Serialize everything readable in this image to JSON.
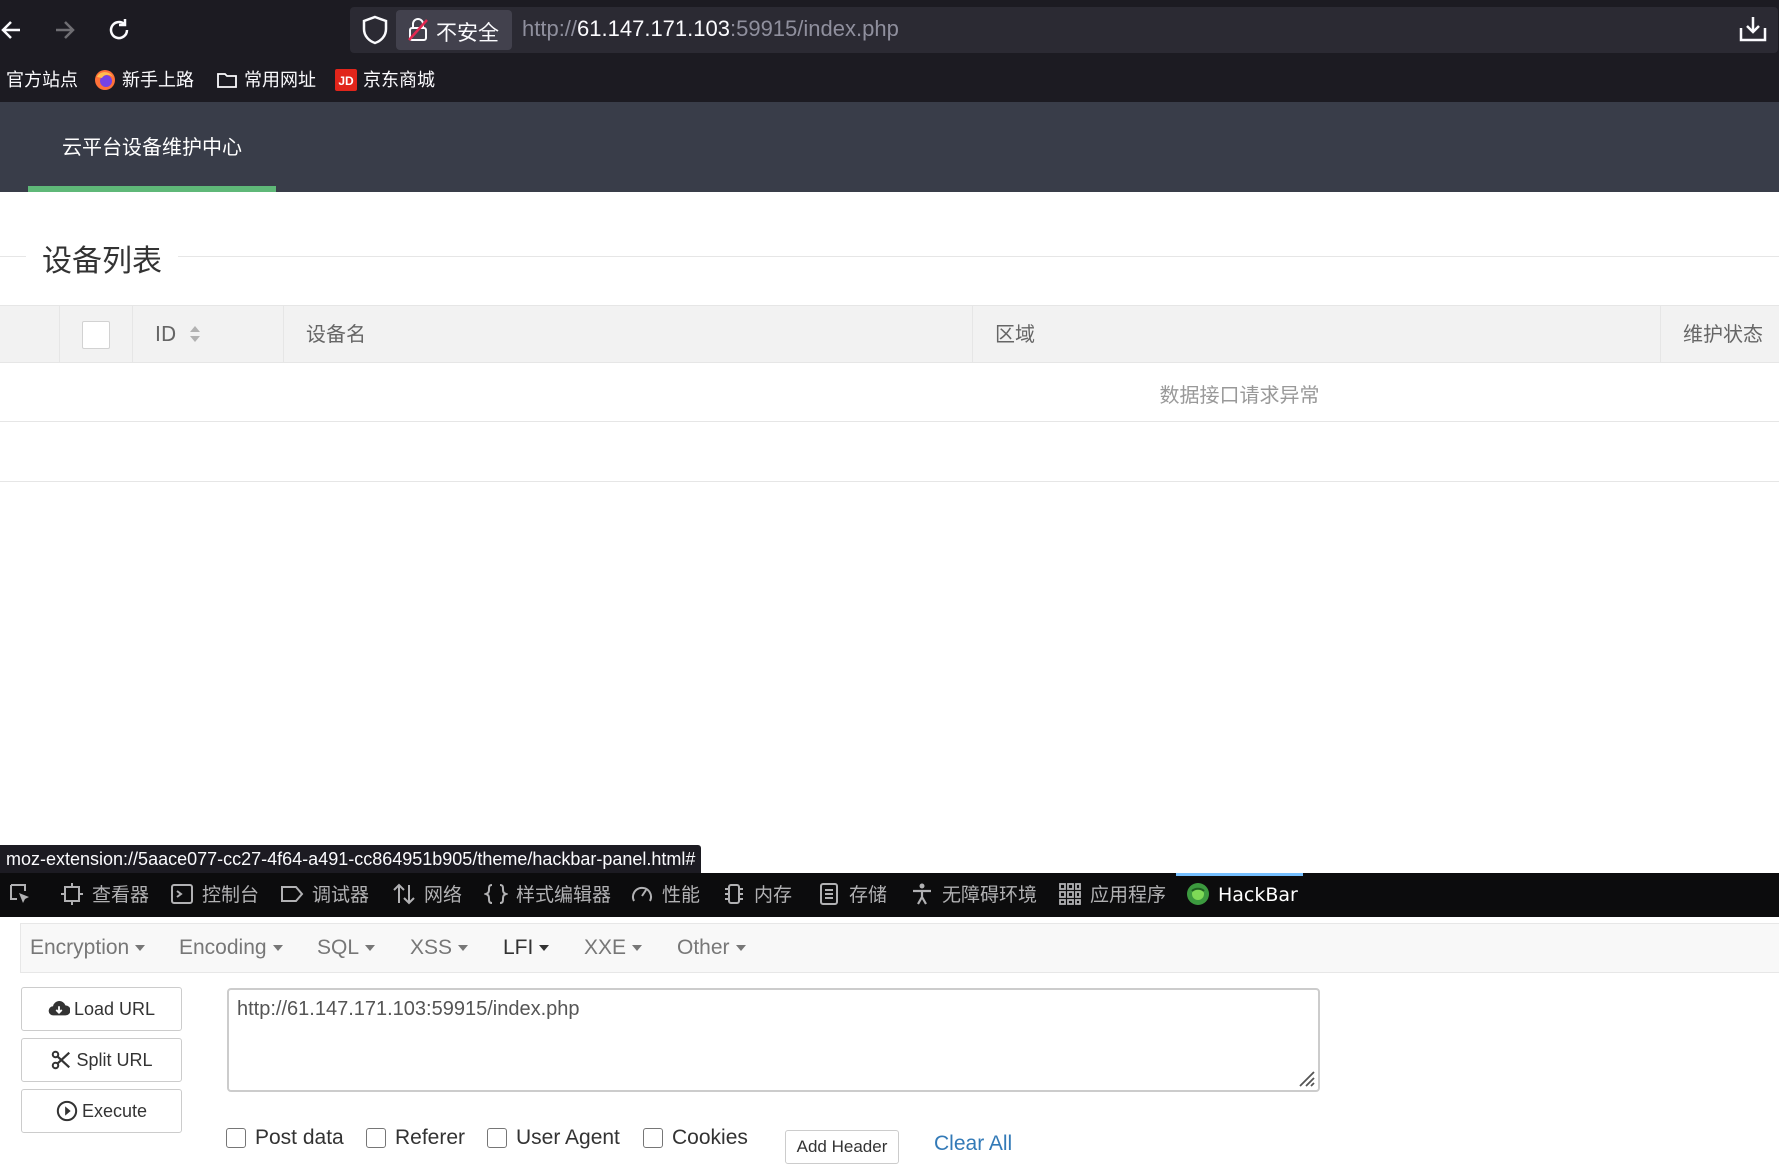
{
  "browser": {
    "insecure_label": "不安全",
    "url_scheme": "http://",
    "url_host": "61.147.171.103",
    "url_rest": ":59915/index.php",
    "bookmarks": [
      {
        "label": "官方站点",
        "icon": "firefox-partial-icon"
      },
      {
        "label": "新手上路",
        "icon": "firefox-icon"
      },
      {
        "label": "常用网址",
        "icon": "folder-icon"
      },
      {
        "label": "京东商城",
        "icon": "jd-icon"
      }
    ]
  },
  "page": {
    "brand": "云平台设备维护中心",
    "section_title": "设备列表",
    "table": {
      "columns": [
        "ID",
        "设备名",
        "区域",
        "维护状态"
      ],
      "empty_message": "数据接口请求异常"
    }
  },
  "status_link": "moz-extension://5aace077-cc27-4f64-a491-cc864951b905/theme/hackbar-panel.html#",
  "devtools": {
    "tabs": [
      "查看器",
      "控制台",
      "调试器",
      "网络",
      "样式编辑器",
      "性能",
      "内存",
      "存储",
      "无障碍环境",
      "应用程序",
      "HackBar"
    ],
    "active_tab": "HackBar"
  },
  "hackbar": {
    "menu": [
      "Encryption",
      "Encoding",
      "SQL",
      "XSS",
      "LFI",
      "XXE",
      "Other"
    ],
    "active_menu": "LFI",
    "buttons": {
      "load": "Load URL",
      "split": "Split URL",
      "execute": "Execute"
    },
    "url_value": "http://61.147.171.103:59915/index.php",
    "checkboxes": [
      "Post data",
      "Referer",
      "User Agent",
      "Cookies"
    ],
    "add_header": "Add Header",
    "clear_all": "Clear All"
  },
  "colors": {
    "header_bg": "#393d49",
    "brand_accent": "#5fb878",
    "devtools_active": "#75bfff",
    "link": "#337ab7"
  }
}
